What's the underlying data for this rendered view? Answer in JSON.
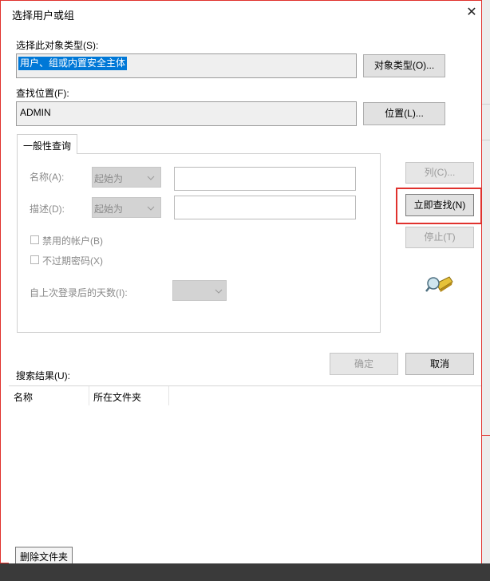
{
  "window": {
    "title": "选择用户或组",
    "close_glyph": "✕"
  },
  "object_type": {
    "label": "选择此对象类型(S):",
    "value": "用户、组或内置安全主体",
    "button": "对象类型(O)..."
  },
  "location": {
    "label": "查找位置(F):",
    "value": "ADMIN",
    "button": "位置(L)..."
  },
  "tab": {
    "label": "一般性查询"
  },
  "query": {
    "name_label": "名称(A):",
    "name_mode": "起始为",
    "desc_label": "描述(D):",
    "desc_mode": "起始为",
    "disabled_accounts": "禁用的帐户(B)",
    "non_expiring_pwd": "不过期密码(X)",
    "days_label": "自上次登录后的天数(I):"
  },
  "buttons": {
    "columns": "列(C)...",
    "find_now": "立即查找(N)",
    "stop": "停止(T)",
    "ok": "确定",
    "cancel": "取消"
  },
  "results": {
    "label": "搜索结果(U):",
    "columns": [
      "名称",
      "所在文件夹"
    ]
  },
  "tooltip": {
    "text": "删除文件夹"
  },
  "colors": {
    "highlight_border": "#e0322e",
    "selection": "#0078d7"
  }
}
